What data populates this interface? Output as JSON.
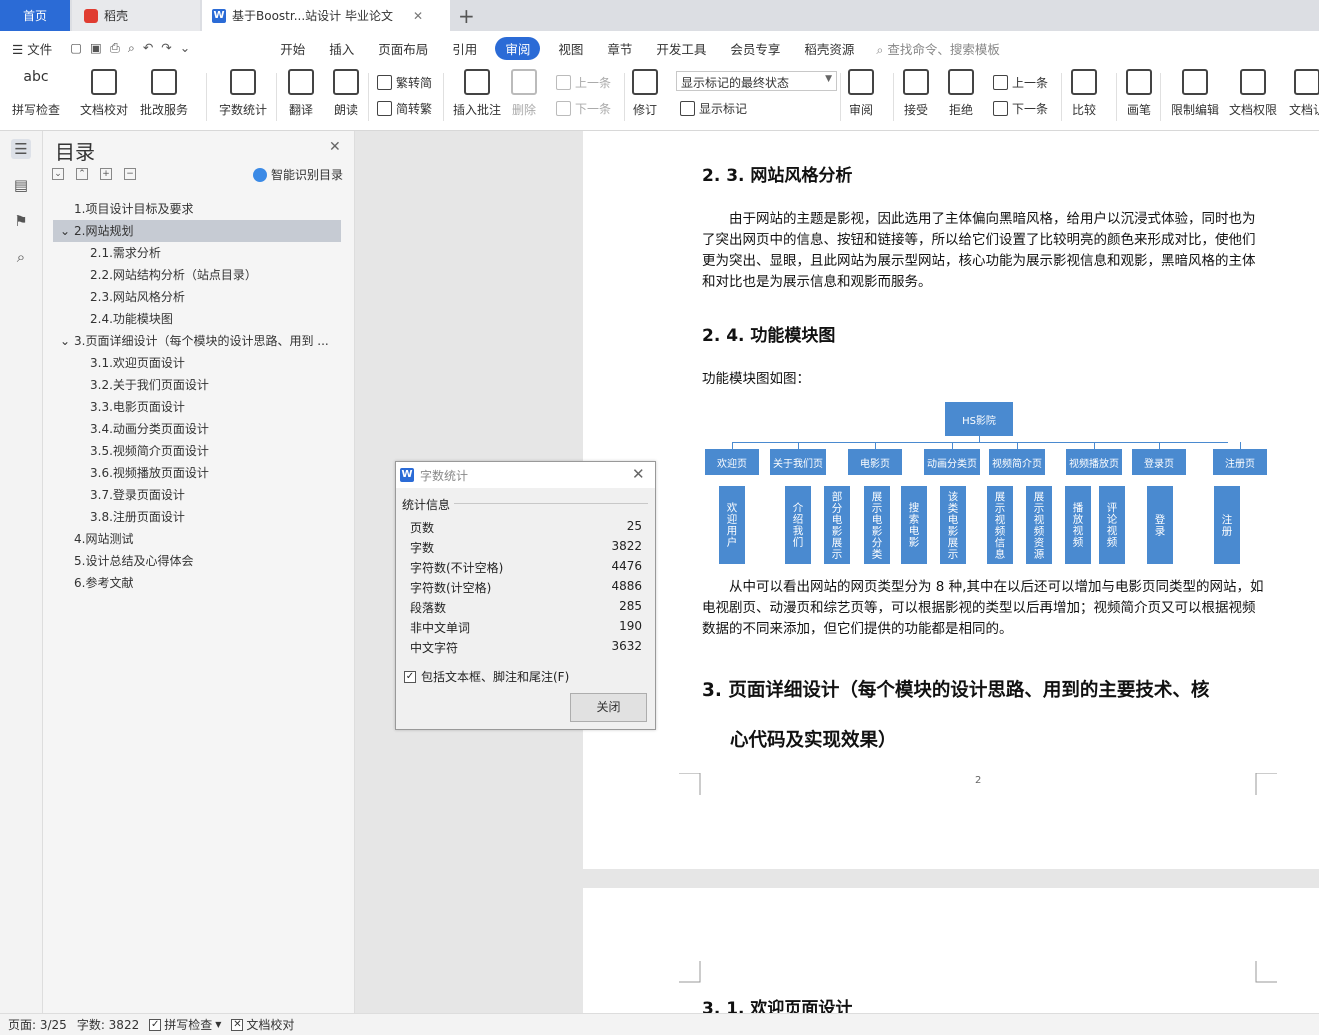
{
  "tabs": {
    "home": "首页",
    "daoke": "稻壳",
    "doc": "基于Boostr...站设计 毕业论文"
  },
  "menu": {
    "file": "文件",
    "items": [
      "开始",
      "插入",
      "页面布局",
      "引用"
    ],
    "active": "审阅",
    "items2": [
      "视图",
      "章节",
      "开发工具",
      "会员专享",
      "稻壳资源"
    ],
    "search": "查找命令、搜索模板"
  },
  "ribbon": {
    "spell": "拼写检查",
    "proof": "文档校对",
    "batch": "批改服务",
    "count": "字数统计",
    "translate": "翻译",
    "read": "朗读",
    "trad": "繁转简",
    "simp": "简转繁",
    "insert_comment": "插入批注",
    "delete": "删除",
    "prev": "上一条",
    "next": "下一条",
    "revise": "修订",
    "mark_state": "显示标记的最终状态",
    "show_marks": "显示标记",
    "review": "审阅",
    "accept": "接受",
    "reject": "拒绝",
    "prev2": "上一条",
    "next2": "下一条",
    "compare": "比较",
    "pen": "画笔",
    "restrict": "限制编辑",
    "perm": "文档权限",
    "docx": "文档认"
  },
  "toc": {
    "title": "目录",
    "smart": "智能识别目录",
    "items": [
      "1.项目设计目标及要求",
      "2.网站规划",
      "2.1.需求分析",
      "2.2.网站结构分析（站点目录）",
      "2.3.网站风格分析",
      "2.4.功能模块图",
      "3.页面详细设计（每个模块的设计思路、用到 ...",
      "3.1.欢迎页面设计",
      "3.2.关于我们页面设计",
      "3.3.电影页面设计",
      "3.4.动画分类页面设计",
      "3.5.视频简介页面设计",
      "3.6.视频播放页面设计",
      "3.7.登录页面设计",
      "3.8.注册页面设计",
      "4.网站测试",
      "5.设计总结及心得体会",
      "6.参考文献"
    ]
  },
  "doc": {
    "h_style": "2. 3. 网站风格分析",
    "p_style": "由于网站的主题是影视，因此选用了主体偏向黑暗风格，给用户以沉浸式体验，同时也为了突出网页中的信息、按钮和链接等，所以给它们设置了比较明亮的颜色来形成对比，使他们更为突出、显眼，且此网站为展示型网站，核心功能为展示影视信息和观影，黑暗风格的主体和对比也是为展示信息和观影而服务。",
    "h_module": "2. 4. 功能模块图",
    "p_intro": "功能模块图如图：",
    "p_after": "从中可以看出网站的网页类型分为 8 种,其中在以后还可以增加与电影页同类型的网站，如电视剧页、动漫页和综艺页等，可以根据影视的类型以后再增加；视频简介页又可以根据视频数据的不同来添加，但它们提供的功能都是相同的。",
    "h3_line1": "3.  页面详细设计（每个模块的设计思路、用到的主要技术、核",
    "h3_line2": "心代码及实现效果）",
    "page_num": "2",
    "h_welcome": "3. 1. 欢迎页面设计"
  },
  "diagram": {
    "root": "HS影院",
    "pages": [
      "欢迎页",
      "关于我们页",
      "电影页",
      "动画分类页",
      "视频简介页",
      "视频播放页",
      "登录页",
      "注册页"
    ],
    "leaves": [
      "欢迎用户",
      "介绍我们",
      "部分电影展示",
      "展示电影分类",
      "搜索电影",
      "该类电影展示",
      "展示视频信息",
      "展示视频资源",
      "播放视频",
      "评论视频",
      "登录",
      "注册"
    ]
  },
  "dialog": {
    "title": "字数统计",
    "section": "统计信息",
    "rows": [
      [
        "页数",
        "25"
      ],
      [
        "字数",
        "3822"
      ],
      [
        "字符数(不计空格)",
        "4476"
      ],
      [
        "字符数(计空格)",
        "4886"
      ],
      [
        "段落数",
        "285"
      ],
      [
        "非中文单词",
        "190"
      ],
      [
        "中文字符",
        "3632"
      ]
    ],
    "include": "包括文本框、脚注和尾注(F)",
    "close": "关闭"
  },
  "status": {
    "page": "页面: 3/25",
    "words": "字数: 3822",
    "spell": "拼写检查",
    "proof": "文档校对"
  }
}
